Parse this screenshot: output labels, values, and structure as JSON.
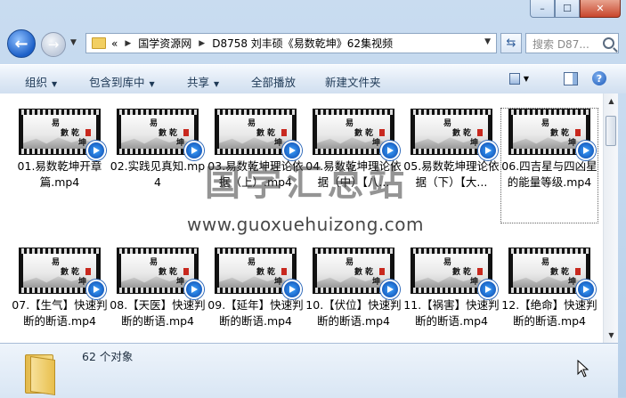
{
  "window": {
    "minimize_label": "–",
    "maximize_label": "☐",
    "close_label": "✕"
  },
  "nav": {
    "back_label": "←",
    "forward_label": "→",
    "crumb_prefix": "«",
    "crumbs": [
      "国学资源网",
      "D8758 刘丰硕《易数乾坤》62集视频"
    ],
    "search_placeholder": "搜索 D87..."
  },
  "toolbar": {
    "organize": "组织",
    "include_library": "包含到库中",
    "share": "共享",
    "play_all": "全部播放",
    "new_folder": "新建文件夹",
    "help": "?"
  },
  "thumb_text": {
    "c1": "易",
    "c2": "數",
    "c3": "乾",
    "c4": "坤"
  },
  "files": [
    {
      "name": "01.易数乾坤开章篇.mp4"
    },
    {
      "name": "02.实践见真知.mp4"
    },
    {
      "name": "03.易数乾坤理论依据（上）.mp4"
    },
    {
      "name": "04.易数乾坤理论依据（中）【八..."
    },
    {
      "name": "05.易数乾坤理论依据（下）【大..."
    },
    {
      "name": "06.四吉星与四凶星的能量等级.mp4"
    },
    {
      "name": "07.【生气】快速判断的断语.mp4"
    },
    {
      "name": "08.【天医】快速判断的断语.mp4"
    },
    {
      "name": "09.【延年】快速判断的断语.mp4"
    },
    {
      "name": "10.【伏位】快速判断的断语.mp4"
    },
    {
      "name": "11.【祸害】快速判断的断语.mp4"
    },
    {
      "name": "12.【绝命】快速判断的断语.mp4"
    }
  ],
  "watermark": {
    "title": "国学汇总站",
    "url": "www.guoxuehuizong.com"
  },
  "details": {
    "count": "62 个对象"
  },
  "scroll": {
    "up": "▲",
    "down": "▼"
  }
}
